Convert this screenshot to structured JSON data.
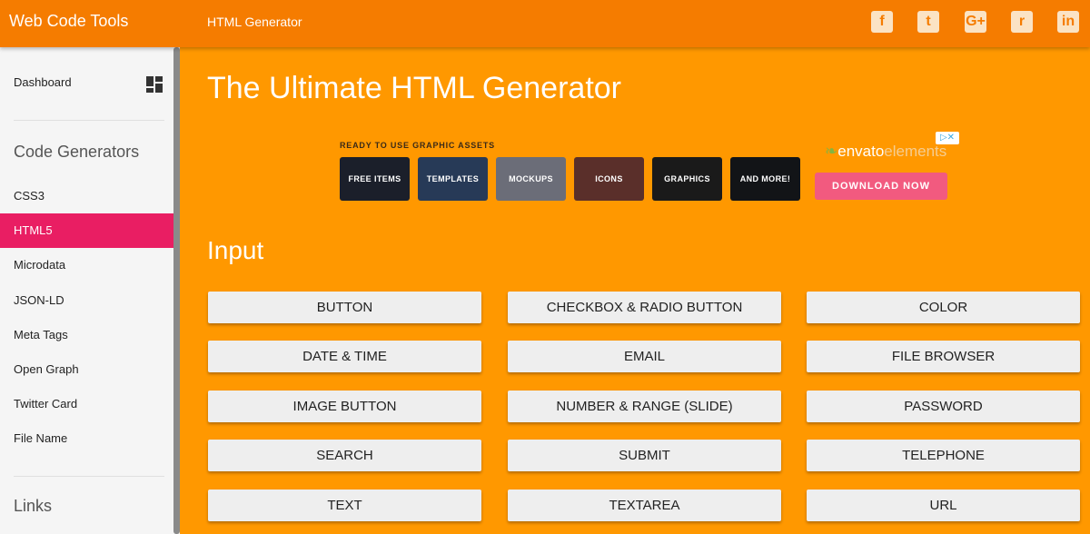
{
  "header": {
    "brand": "Web Code Tools",
    "page": "HTML Generator",
    "social": [
      {
        "name": "facebook-icon",
        "glyph": "f"
      },
      {
        "name": "twitter-icon",
        "glyph": "t"
      },
      {
        "name": "google-plus-icon",
        "glyph": "G+"
      },
      {
        "name": "reddit-icon",
        "glyph": "r"
      },
      {
        "name": "linkedin-icon",
        "glyph": "in"
      }
    ]
  },
  "sidebar": {
    "dashboard": "Dashboard",
    "code_generators_heading": "Code Generators",
    "items": [
      "CSS3",
      "HTML5",
      "Microdata",
      "JSON-LD",
      "Meta Tags",
      "Open Graph",
      "Twitter Card",
      "File Name"
    ],
    "active_item": "HTML5",
    "links_heading": "Links"
  },
  "main": {
    "title": "The Ultimate HTML Generator",
    "section_title": "Input"
  },
  "ad": {
    "caption": "READY TO USE GRAPHIC ASSETS",
    "tiles": [
      "FREE ITEMS",
      "TEMPLATES",
      "MOCKUPS",
      "ICONS",
      "GRAPHICS",
      "AND MORE!"
    ],
    "brand": "envato",
    "brand_suffix": "elements",
    "cta": "DOWNLOAD NOW"
  },
  "buttons": [
    "BUTTON",
    "CHECKBOX & RADIO BUTTON",
    "COLOR",
    "DATE & TIME",
    "EMAIL",
    "FILE BROWSER",
    "IMAGE BUTTON",
    "NUMBER & RANGE (SLIDE)",
    "PASSWORD",
    "SEARCH",
    "SUBMIT",
    "TELEPHONE",
    "TEXT",
    "TEXTAREA",
    "URL"
  ],
  "colors": {
    "page_bg": "#ff9800",
    "topbar_bg": "#f57c00",
    "active_item_bg": "#e91e63",
    "cta_bg": "#f25a7f"
  }
}
